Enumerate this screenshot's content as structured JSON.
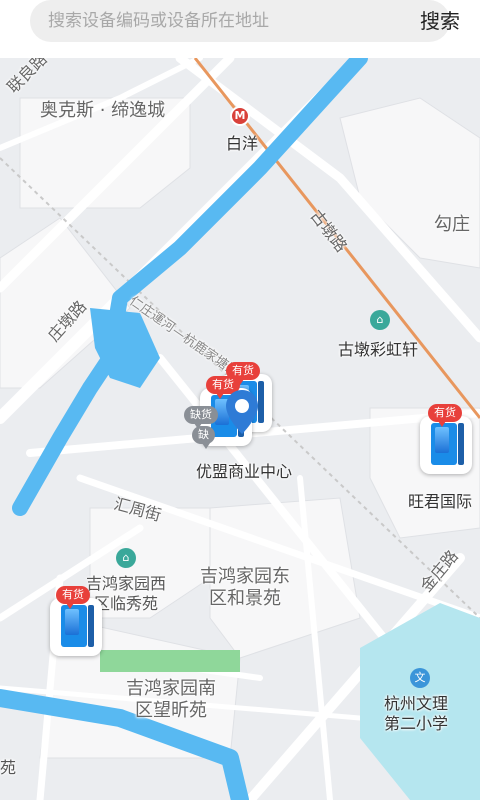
{
  "search": {
    "placeholder": "搜索设备编码或设备所在地址",
    "button_label": "搜索"
  },
  "map": {
    "colors": {
      "background": "#ebedf0",
      "block": "#f7f7f8",
      "road": "#ffffff",
      "water": "#58b9f2",
      "metro_line": "#e8975e",
      "park": "#8fd79a",
      "school_area": "#b5e6ef"
    },
    "labels": {
      "lianliang_road": "联良路",
      "aokesi": "奥克斯 · 缔逸城",
      "baiyang": "白洋",
      "gudun_road": "古墩路",
      "gouzhuang": "勾庄",
      "zhuangdun_road": "庄墩路",
      "metro_name": "仁庄運河—杭鹿家塘路",
      "gudun_rainbow": "古墩彩虹轩",
      "youmeng": "优盟商业中心",
      "huizhou_street": "汇周街",
      "wangjun": "旺君国际",
      "jihong_west": "吉鸿家园西\n区临秀苑",
      "jihong_east": "吉鸿家园东\n区和景苑",
      "jinzhuang_road": "金庄路",
      "jihong_south": "吉鸿家园南\n区望昕苑",
      "wenli_school": "杭州文理\n第二小学",
      "bottom_left": "苑"
    },
    "markers": {
      "badge_in_stock": "有货",
      "badge_out_of_stock": "缺货",
      "badge_out_short": "缺"
    },
    "icons": {
      "metro": "metro-icon",
      "poi": "building-icon",
      "school": "school-icon",
      "pin": "location-pin-icon",
      "map_pin_button": "map-pin-icon"
    }
  }
}
